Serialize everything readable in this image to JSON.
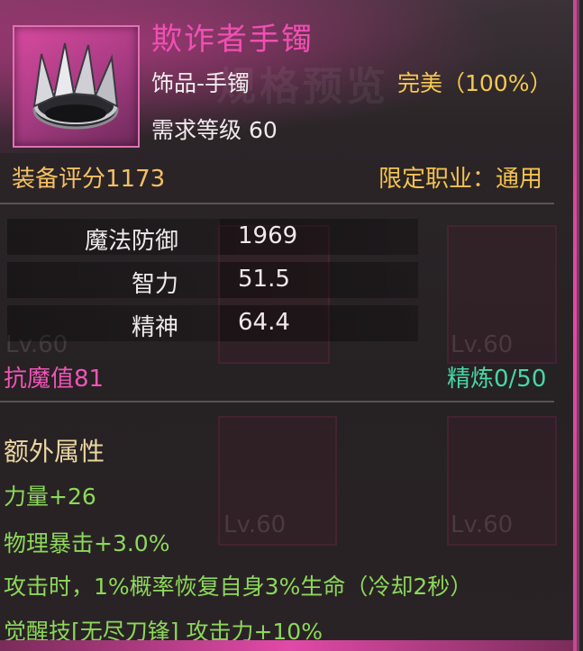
{
  "item": {
    "name": "欺诈者手镯",
    "type": "饰品-手镯",
    "required_level": "需求等级 60",
    "quality": "完美（100%）",
    "icon": "bracelet-icon"
  },
  "summary": {
    "score": "装备评分1173",
    "job_restriction": "限定职业：通用"
  },
  "stats": [
    {
      "label": "魔法防御",
      "value": "1969"
    },
    {
      "label": "智力",
      "value": "51.5"
    },
    {
      "label": "精神",
      "value": "64.4"
    }
  ],
  "resist": "抗魔值81",
  "refine": "精炼0/50",
  "extra": {
    "title": "额外属性",
    "lines": [
      "力量+26",
      "物理暴击+3.0%",
      "攻击时，1%概率恢复自身3%生命（冷却2秒）",
      "觉醒技[无尽刀锋] 攻击力+10%"
    ]
  },
  "background": {
    "watermark": "规格预览",
    "lv_labels": [
      "Lv.60",
      "Lv.60",
      "Lv.60",
      "Lv.60"
    ]
  },
  "colors": {
    "accent_pink": "#f04fb2",
    "gold": "#f4c063",
    "green": "#8cd85a",
    "teal": "#48d6a6"
  }
}
